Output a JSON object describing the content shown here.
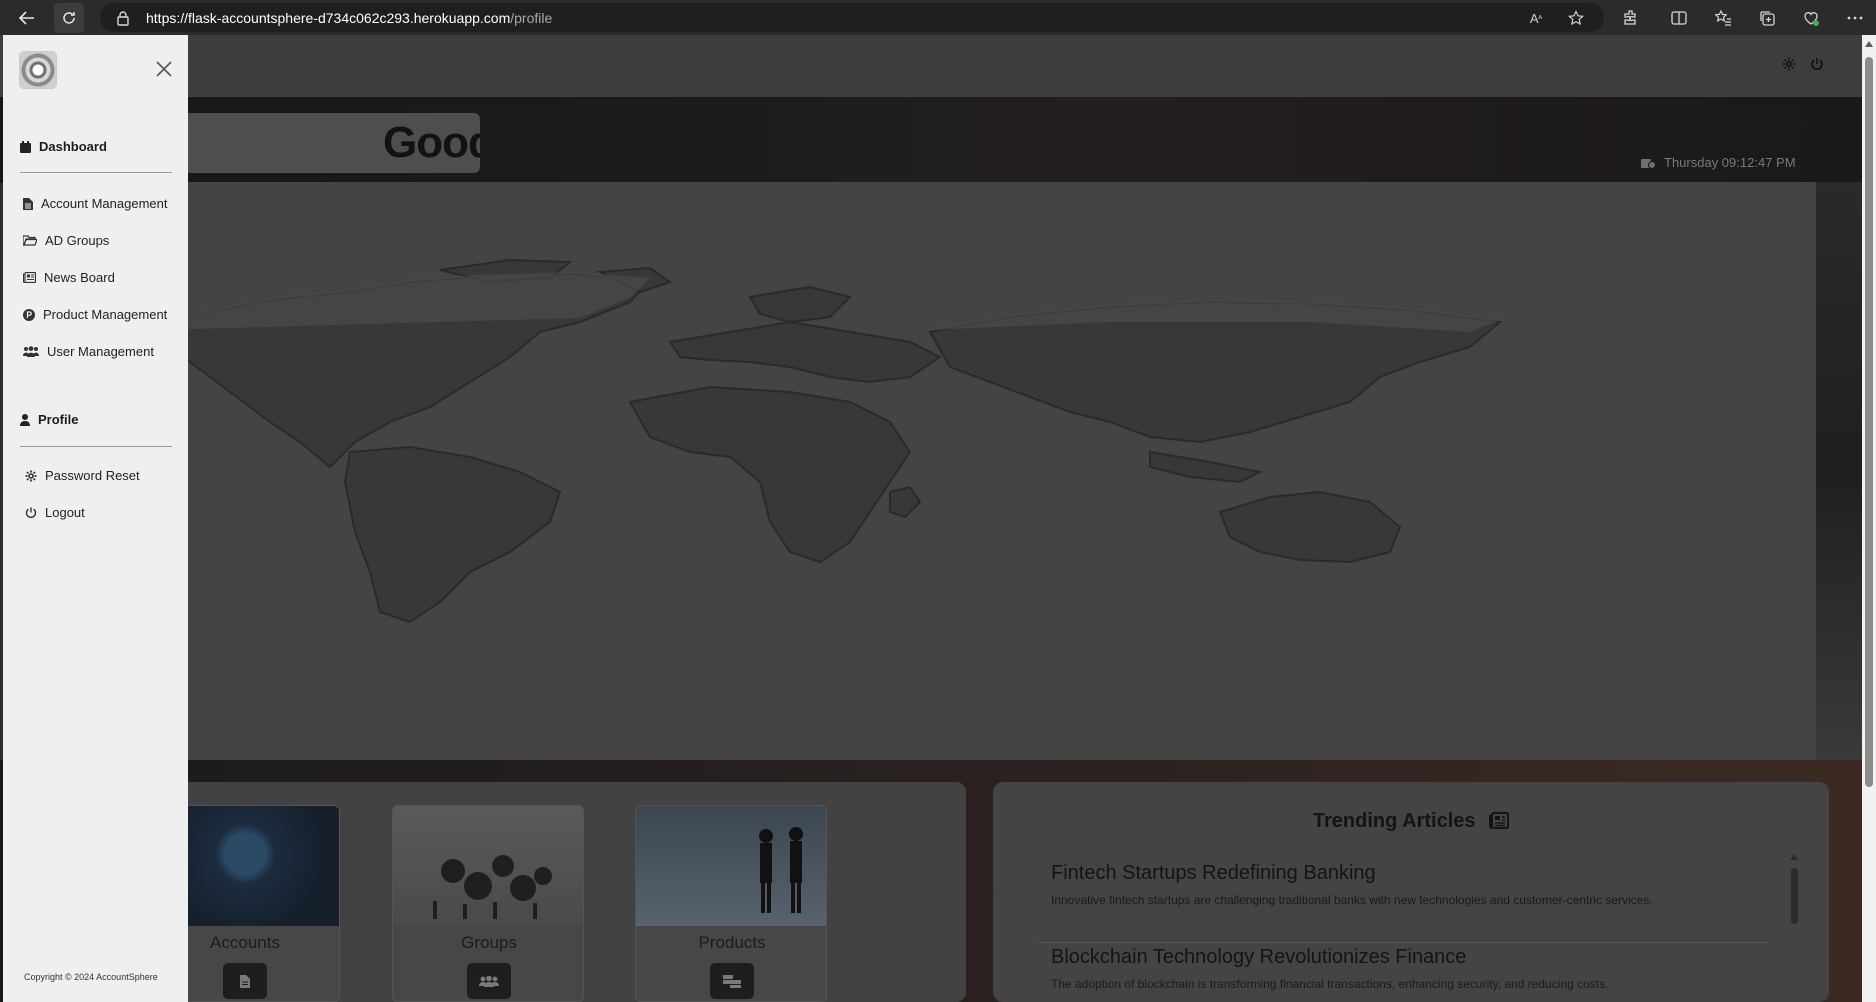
{
  "browser": {
    "url_host": "https://flask-accountsphere-d734c062c293.herokuapp.com",
    "url_path": "/profile"
  },
  "header": {
    "greeting": "Good",
    "datetime": "Thursday 09:12:47 PM"
  },
  "sidebar": {
    "dashboard_label": "Dashboard",
    "items": [
      {
        "label": "Account Management",
        "icon": "file-icon"
      },
      {
        "label": "AD Groups",
        "icon": "folder-open-icon"
      },
      {
        "label": "News Board",
        "icon": "newspaper-icon"
      },
      {
        "label": "Product Management",
        "icon": "product-hunt-icon"
      },
      {
        "label": "User Management",
        "icon": "users-icon"
      }
    ],
    "profile_label": "Profile",
    "profile_items": [
      {
        "label": "Password Reset",
        "icon": "gear-icon"
      },
      {
        "label": "Logout",
        "icon": "power-icon"
      }
    ],
    "copyright": "Copyright © 2024 AccountSphere"
  },
  "tiles": [
    {
      "label": "Accounts",
      "icon": "file-icon"
    },
    {
      "label": "Groups",
      "icon": "users-icon"
    },
    {
      "label": "Products",
      "icon": "boxes-icon"
    }
  ],
  "trending": {
    "title": "Trending Articles",
    "articles": [
      {
        "title": "Fintech Startups Redefining Banking",
        "summary": "Innovative fintech startups are challenging traditional banks with new technologies and customer-centric services."
      },
      {
        "title": "Blockchain Technology Revolutionizes Finance",
        "summary": "The adoption of blockchain is transforming financial transactions, enhancing security, and reducing costs."
      }
    ]
  }
}
